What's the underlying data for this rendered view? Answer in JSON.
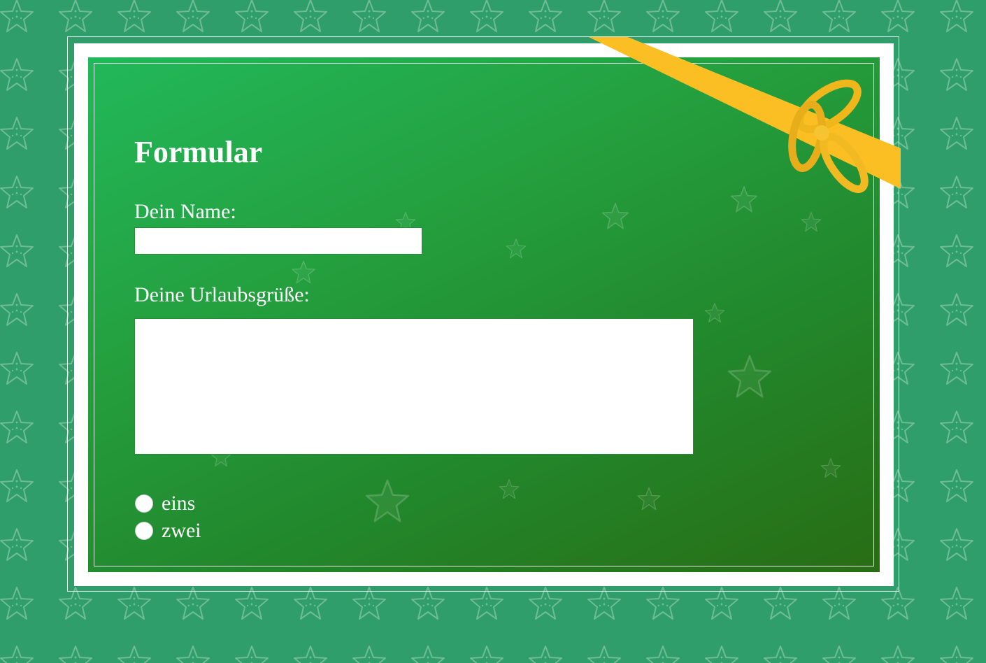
{
  "form": {
    "title": "Formular",
    "name_label": "Dein Name:",
    "name_value": "",
    "message_label": "Deine Urlaubsgrüße:",
    "message_value": "",
    "radio_options": [
      {
        "label": "eins",
        "checked": false
      },
      {
        "label": "zwei",
        "checked": false
      }
    ]
  },
  "decorations": {
    "background_pattern_icon": "starfish-outline-icon",
    "ribbon_icon": "ribbon-bow-icon"
  },
  "colors": {
    "page_background": "#2f9e6a",
    "card_gradient_start": "#22b85a",
    "card_gradient_end": "#286d14",
    "card_frame": "#ffffff",
    "ribbon": "#fbbf24",
    "text": "#ffffff"
  }
}
